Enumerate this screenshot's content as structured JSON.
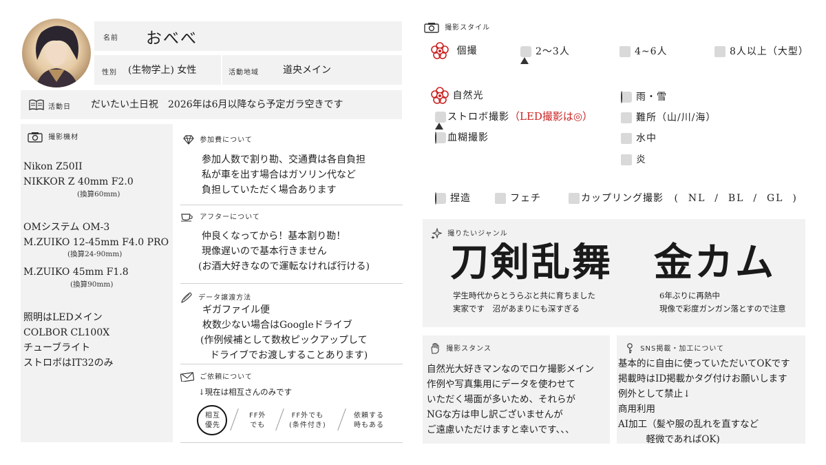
{
  "profile": {
    "name_label": "名前",
    "name": "おべべ",
    "gender_label": "性別",
    "gender": "(生物学上) 女性",
    "area_label": "活動地域",
    "area": "道央メイン",
    "days_label": "活動日",
    "days": "だいたい土日祝　2026年は6月以降なら予定ガラ空きです"
  },
  "equipment": {
    "title": "撮影機材",
    "lines": [
      {
        "text": "Nikon  Z50II"
      },
      {
        "text": "NIKKOR  Z  40mm  F2.0"
      },
      {
        "note": "(換算60mm)"
      },
      {
        "text": "OMシステム  OM-3"
      },
      {
        "text": "M.ZUIKO  12-45mm  F4.0  PRO"
      },
      {
        "note": "(換算24-90mm)"
      },
      {
        "text": "M.ZUIKO  45mm  F1.8"
      },
      {
        "note": "(換算90mm)"
      },
      {
        "text": "照明はLEDメイン"
      },
      {
        "text": "COLBOR  CL100X"
      },
      {
        "text": "チューブライト"
      },
      {
        "text": "ストロボはIT32のみ"
      }
    ]
  },
  "fee": {
    "title": "参加費について",
    "lines": [
      "参加人数で割り勘、交通費は各自負担",
      "私が車を出す場合はガソリン代など",
      "負担していただく場合あります"
    ]
  },
  "after": {
    "title": "アフターについて",
    "lines": [
      "仲良くなってから！基本割り勘！",
      "現像遅いので基本行きません",
      "(お酒大好きなので運転なければ行ける)"
    ]
  },
  "delivery": {
    "title": "データ譲渡方法",
    "lines": [
      "ギガファイル便",
      "枚数少ない場合はGoogleドライブ",
      "(作例候補として数枚ピックアップして",
      "　ドライブでお渡しすることあります)"
    ]
  },
  "request": {
    "title": "ご依頼について",
    "note": "↓現在は相互さんのみです",
    "options": [
      {
        "line1": "相互",
        "line2": "優先"
      },
      {
        "line1": "FF外",
        "line2": "でも"
      },
      {
        "line1": "FF外でも",
        "line2": "(条件付き)"
      },
      {
        "line1": "依頼する",
        "line2": "時もある"
      }
    ]
  },
  "style": {
    "title": "撮影スタイル",
    "people": [
      "個撮",
      "2〜3人",
      "4~6人",
      "8人以上（大型）"
    ],
    "col1": [
      "自然光",
      "ストロボ撮影",
      "血糊撮影"
    ],
    "led_note": "（LED撮影は◎）",
    "col2": [
      "雨・雪",
      "難所（山/川/海）",
      "水中",
      "炎"
    ],
    "row3": {
      "capture": "捏造",
      "fetish": "フェチ",
      "couple": "カップリング撮影",
      "couple_opts": "(  NL  /  BL  /  GL  )"
    },
    "accent_color": "#cc2222"
  },
  "genre": {
    "title": "撮りたいジャンル",
    "items": [
      {
        "name": "刀剣乱舞",
        "desc1": "学生時代からとうらぶと共に育ちました",
        "desc2": "実家です　沼があまりにも深すぎる"
      },
      {
        "name": "金カム",
        "desc1": "6年ぶりに再熱中",
        "desc2": "現像で彩度ガンガン落とすので注意"
      }
    ]
  },
  "stance": {
    "title": "撮影スタンス",
    "lines": [
      "自然光大好きマンなのでロケ撮影メイン",
      "作例や写真集用にデータを使わせて",
      "いただく場面が多いため、それらが",
      "NGな方は申し訳ございませんが",
      "ご遠慮いただけますと幸いです、、、"
    ]
  },
  "sns": {
    "title": "SNS掲載・加工について",
    "lines": [
      "基本的に自由に使っていただいてOKです",
      "掲載時はID掲載かタグ付けお願いします",
      "例外として禁止↓",
      "商用利用",
      "AI加工（髪や服の乱れを直すなど",
      "　　　軽微であればOK)"
    ]
  }
}
